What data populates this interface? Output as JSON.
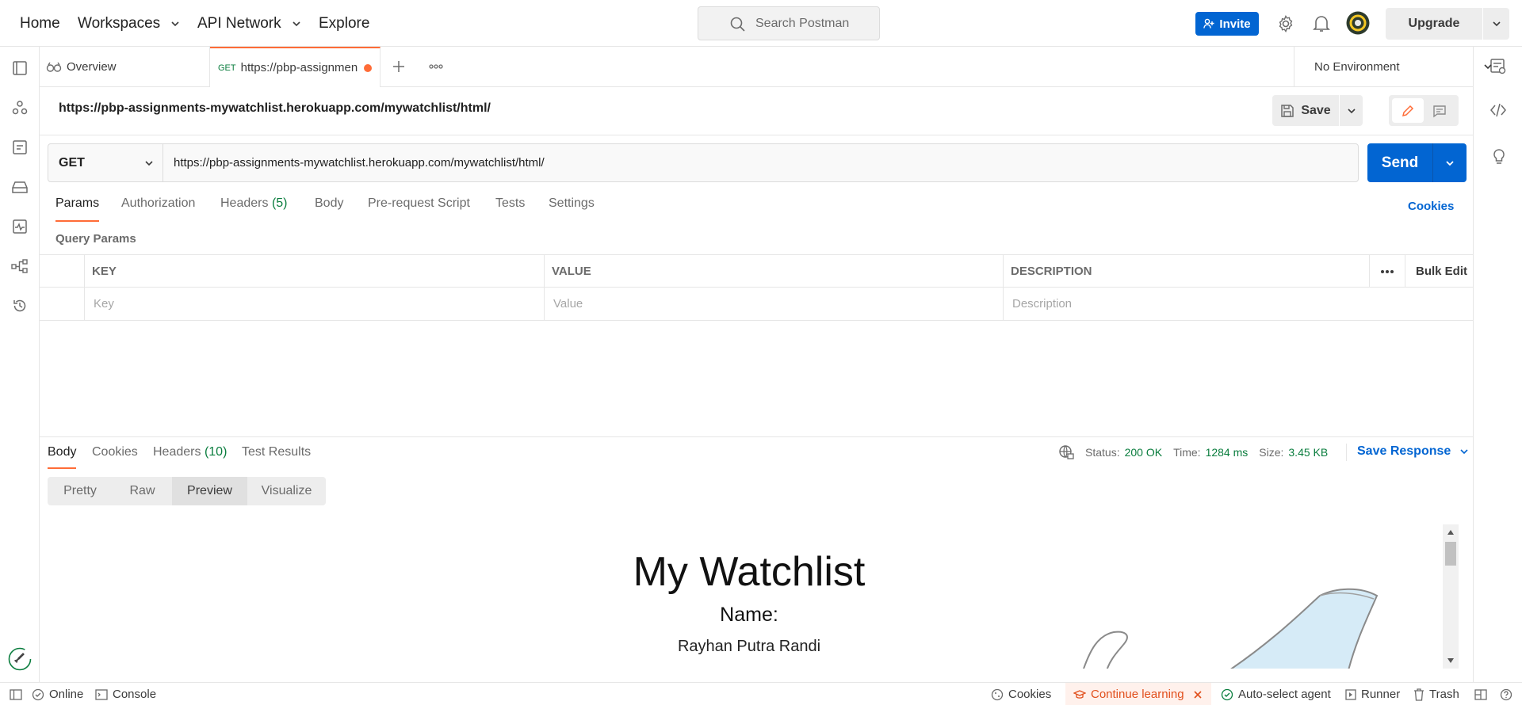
{
  "topbar": {
    "nav": [
      "Home",
      "Workspaces",
      "API Network",
      "Explore"
    ],
    "search_placeholder": "Search Postman",
    "invite_label": "Invite",
    "upgrade_label": "Upgrade"
  },
  "tabs": {
    "overview_label": "Overview",
    "active_method": "GET",
    "active_label": "https://pbp-assignmen",
    "environment": "No Environment"
  },
  "request": {
    "title": "https://pbp-assignments-mywatchlist.herokuapp.com/mywatchlist/html/",
    "save_label": "Save",
    "method": "GET",
    "url": "https://pbp-assignments-mywatchlist.herokuapp.com/mywatchlist/html/",
    "send_label": "Send",
    "tabs": {
      "params": "Params",
      "authorization": "Authorization",
      "headers": "Headers",
      "headers_count": "(5)",
      "body": "Body",
      "prerequest": "Pre-request Script",
      "tests": "Tests",
      "settings": "Settings"
    },
    "cookies_label": "Cookies",
    "query_params_title": "Query Params",
    "table": {
      "key_header": "KEY",
      "value_header": "VALUE",
      "description_header": "DESCRIPTION",
      "bulk_edit": "Bulk Edit",
      "key_placeholder": "Key",
      "value_placeholder": "Value",
      "description_placeholder": "Description"
    }
  },
  "response": {
    "tabs": {
      "body": "Body",
      "cookies": "Cookies",
      "headers": "Headers",
      "headers_count": "(10)",
      "test_results": "Test Results"
    },
    "status_label": "Status:",
    "status_value": "200 OK",
    "time_label": "Time:",
    "time_value": "1284 ms",
    "size_label": "Size:",
    "size_value": "3.45 KB",
    "save_response": "Save Response",
    "views": [
      "Pretty",
      "Raw",
      "Preview",
      "Visualize"
    ],
    "active_view": "Preview",
    "preview": {
      "title": "My Watchlist",
      "name_label": "Name:",
      "name_value": "Rayhan Putra Randi"
    }
  },
  "statusbar": {
    "online": "Online",
    "console": "Console",
    "cookies": "Cookies",
    "continue_learning": "Continue learning",
    "auto_select_agent": "Auto-select agent",
    "runner": "Runner",
    "trash": "Trash"
  },
  "colors": {
    "accent": "#ff6c37",
    "primary": "#0265d2",
    "success": "#0a7d3e"
  }
}
